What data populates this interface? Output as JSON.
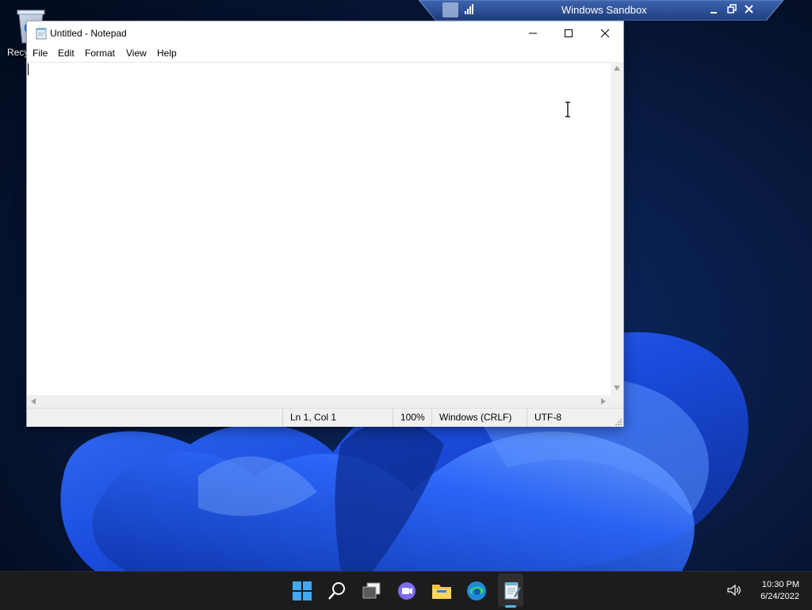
{
  "desktop": {
    "recycle_label": "Recy"
  },
  "sandbox": {
    "title": "Windows Sandbox"
  },
  "notepad": {
    "title": "Untitled - Notepad",
    "menu": [
      "File",
      "Edit",
      "Format",
      "View",
      "Help"
    ],
    "content": "",
    "status": {
      "position": "Ln 1, Col 1",
      "zoom": "100%",
      "line_ending": "Windows (CRLF)",
      "encoding": "UTF-8"
    }
  },
  "taskbar": {
    "icons": [
      "start-icon",
      "search-icon",
      "task-view-icon",
      "chat-icon",
      "file-explorer-icon",
      "edge-icon",
      "notepad-icon"
    ],
    "clock_time": "10:30 PM",
    "clock_date": "6/24/2022"
  },
  "colors": {
    "sandbox_bar": "#2c4f94",
    "accent": "#5cb4f0",
    "taskbar": "#1c1c1c"
  }
}
